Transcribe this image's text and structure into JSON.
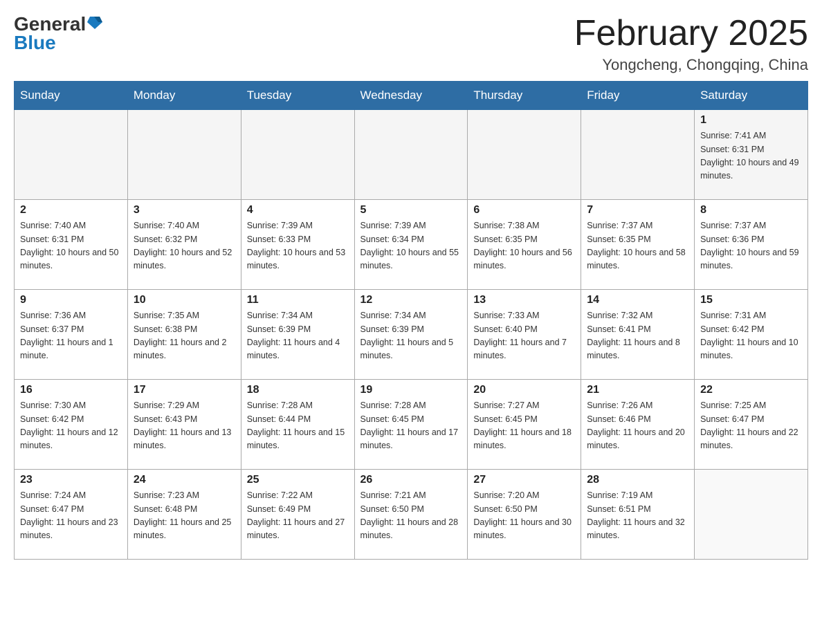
{
  "header": {
    "logo_general": "General",
    "logo_blue": "Blue",
    "title": "February 2025",
    "subtitle": "Yongcheng, Chongqing, China"
  },
  "days_of_week": [
    "Sunday",
    "Monday",
    "Tuesday",
    "Wednesday",
    "Thursday",
    "Friday",
    "Saturday"
  ],
  "weeks": [
    [
      {
        "day": "",
        "sunrise": "",
        "sunset": "",
        "daylight": ""
      },
      {
        "day": "",
        "sunrise": "",
        "sunset": "",
        "daylight": ""
      },
      {
        "day": "",
        "sunrise": "",
        "sunset": "",
        "daylight": ""
      },
      {
        "day": "",
        "sunrise": "",
        "sunset": "",
        "daylight": ""
      },
      {
        "day": "",
        "sunrise": "",
        "sunset": "",
        "daylight": ""
      },
      {
        "day": "",
        "sunrise": "",
        "sunset": "",
        "daylight": ""
      },
      {
        "day": "1",
        "sunrise": "Sunrise: 7:41 AM",
        "sunset": "Sunset: 6:31 PM",
        "daylight": "Daylight: 10 hours and 49 minutes."
      }
    ],
    [
      {
        "day": "2",
        "sunrise": "Sunrise: 7:40 AM",
        "sunset": "Sunset: 6:31 PM",
        "daylight": "Daylight: 10 hours and 50 minutes."
      },
      {
        "day": "3",
        "sunrise": "Sunrise: 7:40 AM",
        "sunset": "Sunset: 6:32 PM",
        "daylight": "Daylight: 10 hours and 52 minutes."
      },
      {
        "day": "4",
        "sunrise": "Sunrise: 7:39 AM",
        "sunset": "Sunset: 6:33 PM",
        "daylight": "Daylight: 10 hours and 53 minutes."
      },
      {
        "day": "5",
        "sunrise": "Sunrise: 7:39 AM",
        "sunset": "Sunset: 6:34 PM",
        "daylight": "Daylight: 10 hours and 55 minutes."
      },
      {
        "day": "6",
        "sunrise": "Sunrise: 7:38 AM",
        "sunset": "Sunset: 6:35 PM",
        "daylight": "Daylight: 10 hours and 56 minutes."
      },
      {
        "day": "7",
        "sunrise": "Sunrise: 7:37 AM",
        "sunset": "Sunset: 6:35 PM",
        "daylight": "Daylight: 10 hours and 58 minutes."
      },
      {
        "day": "8",
        "sunrise": "Sunrise: 7:37 AM",
        "sunset": "Sunset: 6:36 PM",
        "daylight": "Daylight: 10 hours and 59 minutes."
      }
    ],
    [
      {
        "day": "9",
        "sunrise": "Sunrise: 7:36 AM",
        "sunset": "Sunset: 6:37 PM",
        "daylight": "Daylight: 11 hours and 1 minute."
      },
      {
        "day": "10",
        "sunrise": "Sunrise: 7:35 AM",
        "sunset": "Sunset: 6:38 PM",
        "daylight": "Daylight: 11 hours and 2 minutes."
      },
      {
        "day": "11",
        "sunrise": "Sunrise: 7:34 AM",
        "sunset": "Sunset: 6:39 PM",
        "daylight": "Daylight: 11 hours and 4 minutes."
      },
      {
        "day": "12",
        "sunrise": "Sunrise: 7:34 AM",
        "sunset": "Sunset: 6:39 PM",
        "daylight": "Daylight: 11 hours and 5 minutes."
      },
      {
        "day": "13",
        "sunrise": "Sunrise: 7:33 AM",
        "sunset": "Sunset: 6:40 PM",
        "daylight": "Daylight: 11 hours and 7 minutes."
      },
      {
        "day": "14",
        "sunrise": "Sunrise: 7:32 AM",
        "sunset": "Sunset: 6:41 PM",
        "daylight": "Daylight: 11 hours and 8 minutes."
      },
      {
        "day": "15",
        "sunrise": "Sunrise: 7:31 AM",
        "sunset": "Sunset: 6:42 PM",
        "daylight": "Daylight: 11 hours and 10 minutes."
      }
    ],
    [
      {
        "day": "16",
        "sunrise": "Sunrise: 7:30 AM",
        "sunset": "Sunset: 6:42 PM",
        "daylight": "Daylight: 11 hours and 12 minutes."
      },
      {
        "day": "17",
        "sunrise": "Sunrise: 7:29 AM",
        "sunset": "Sunset: 6:43 PM",
        "daylight": "Daylight: 11 hours and 13 minutes."
      },
      {
        "day": "18",
        "sunrise": "Sunrise: 7:28 AM",
        "sunset": "Sunset: 6:44 PM",
        "daylight": "Daylight: 11 hours and 15 minutes."
      },
      {
        "day": "19",
        "sunrise": "Sunrise: 7:28 AM",
        "sunset": "Sunset: 6:45 PM",
        "daylight": "Daylight: 11 hours and 17 minutes."
      },
      {
        "day": "20",
        "sunrise": "Sunrise: 7:27 AM",
        "sunset": "Sunset: 6:45 PM",
        "daylight": "Daylight: 11 hours and 18 minutes."
      },
      {
        "day": "21",
        "sunrise": "Sunrise: 7:26 AM",
        "sunset": "Sunset: 6:46 PM",
        "daylight": "Daylight: 11 hours and 20 minutes."
      },
      {
        "day": "22",
        "sunrise": "Sunrise: 7:25 AM",
        "sunset": "Sunset: 6:47 PM",
        "daylight": "Daylight: 11 hours and 22 minutes."
      }
    ],
    [
      {
        "day": "23",
        "sunrise": "Sunrise: 7:24 AM",
        "sunset": "Sunset: 6:47 PM",
        "daylight": "Daylight: 11 hours and 23 minutes."
      },
      {
        "day": "24",
        "sunrise": "Sunrise: 7:23 AM",
        "sunset": "Sunset: 6:48 PM",
        "daylight": "Daylight: 11 hours and 25 minutes."
      },
      {
        "day": "25",
        "sunrise": "Sunrise: 7:22 AM",
        "sunset": "Sunset: 6:49 PM",
        "daylight": "Daylight: 11 hours and 27 minutes."
      },
      {
        "day": "26",
        "sunrise": "Sunrise: 7:21 AM",
        "sunset": "Sunset: 6:50 PM",
        "daylight": "Daylight: 11 hours and 28 minutes."
      },
      {
        "day": "27",
        "sunrise": "Sunrise: 7:20 AM",
        "sunset": "Sunset: 6:50 PM",
        "daylight": "Daylight: 11 hours and 30 minutes."
      },
      {
        "day": "28",
        "sunrise": "Sunrise: 7:19 AM",
        "sunset": "Sunset: 6:51 PM",
        "daylight": "Daylight: 11 hours and 32 minutes."
      },
      {
        "day": "",
        "sunrise": "",
        "sunset": "",
        "daylight": ""
      }
    ]
  ]
}
